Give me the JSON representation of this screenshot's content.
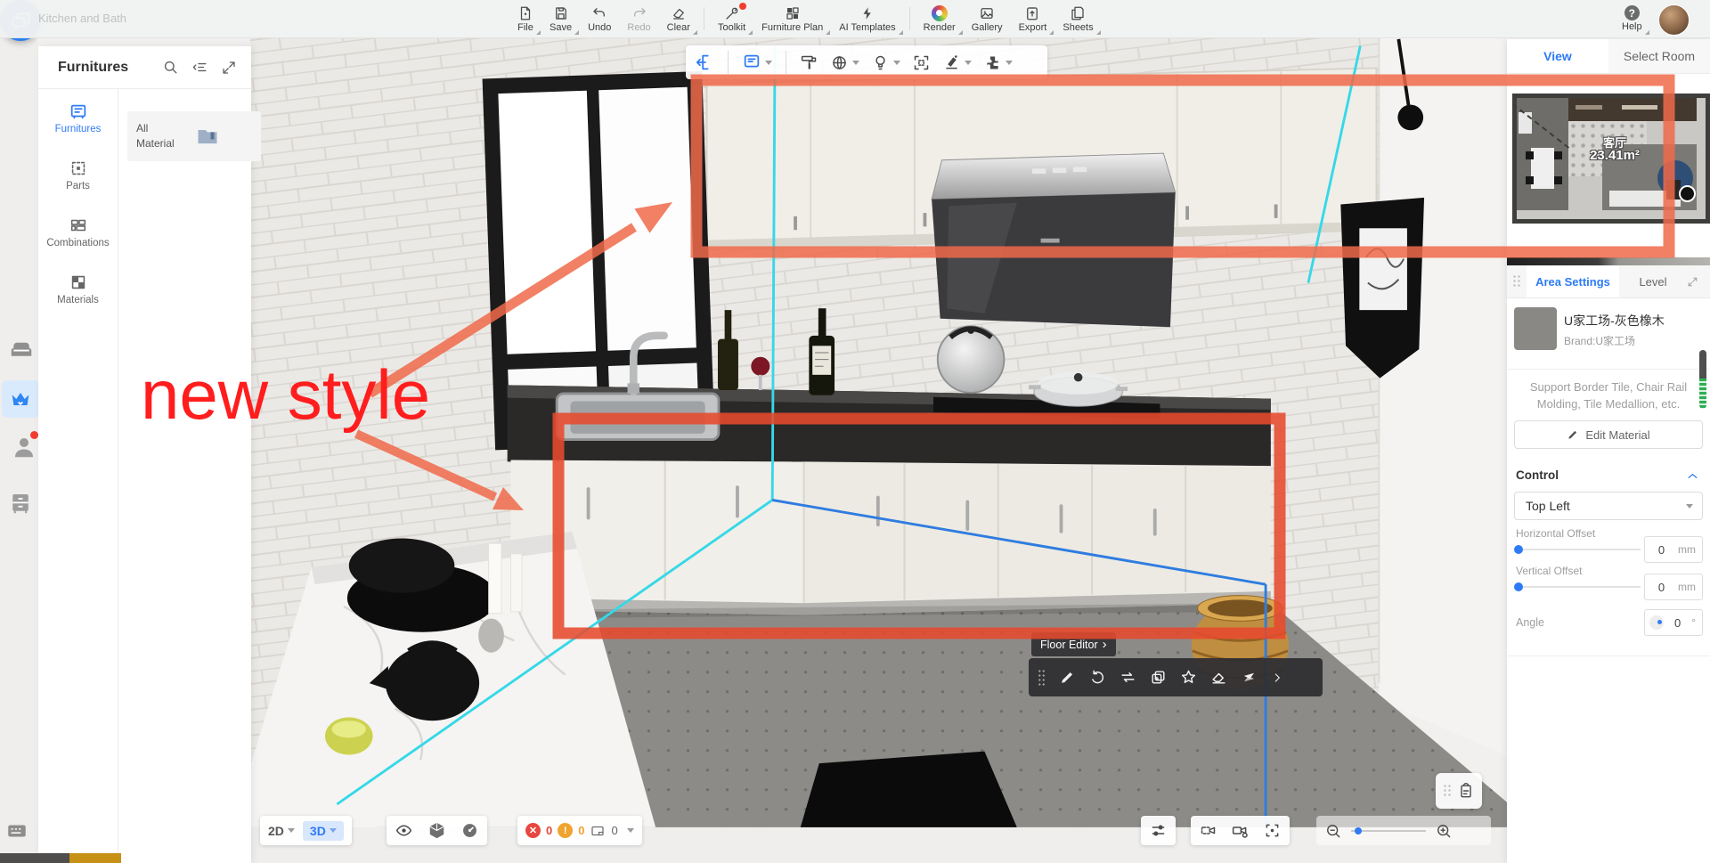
{
  "window": {
    "watermark": "Kitchen and Bath"
  },
  "top_toolbar": {
    "items": [
      {
        "label": "File"
      },
      {
        "label": "Save"
      },
      {
        "label": "Undo"
      },
      {
        "label": "Redo"
      },
      {
        "label": "Clear"
      },
      {
        "label": "Toolkit"
      },
      {
        "label": "Furniture Plan"
      },
      {
        "label": "AI Templates"
      },
      {
        "label": "Render"
      },
      {
        "label": "Gallery"
      },
      {
        "label": "Export"
      },
      {
        "label": "Sheets"
      }
    ],
    "help_label": "Help"
  },
  "left_panel": {
    "title": "Furnitures",
    "nav": [
      {
        "label": "Furnitures"
      },
      {
        "label": "Parts"
      },
      {
        "label": "Combinations"
      },
      {
        "label": "Materials"
      }
    ],
    "all_material_label": "All Material"
  },
  "annotation": {
    "text": "new style"
  },
  "floor_editor": {
    "label": "Floor Editor",
    "chevron": "›"
  },
  "bottom_toolbar": {
    "mode_2d": "2D",
    "mode_3d": "3D",
    "error_count": "0",
    "warning_count": "0",
    "view_count": "0"
  },
  "right_panel": {
    "tabs": {
      "view": "View",
      "select_room": "Select Room"
    },
    "minimap": {
      "room_name": "客厅",
      "room_area": "23.41m²"
    },
    "settings_tabs": {
      "area": "Area Settings",
      "level": "Level"
    },
    "material": {
      "name": "U家工场-灰色橡木",
      "brand": "Brand:U家工场"
    },
    "description": "Support Border Tile, Chair Rail Molding, Tile Medallion, etc.",
    "edit_material_label": "Edit Material",
    "control": {
      "title": "Control",
      "anchor": "Top Left",
      "horizontal_label": "Horizontal Offset",
      "horizontal_value": "0",
      "horizontal_unit": "mm",
      "vertical_label": "Vertical Offset",
      "vertical_value": "0",
      "vertical_unit": "mm",
      "angle_label": "Angle",
      "angle_value": "0",
      "angle_unit": "°"
    }
  },
  "colors": {
    "accent": "#2e7bf6",
    "annotation_red": "#f05a3c",
    "error_red": "#e8473f",
    "warning_orange": "#f0a32f"
  }
}
